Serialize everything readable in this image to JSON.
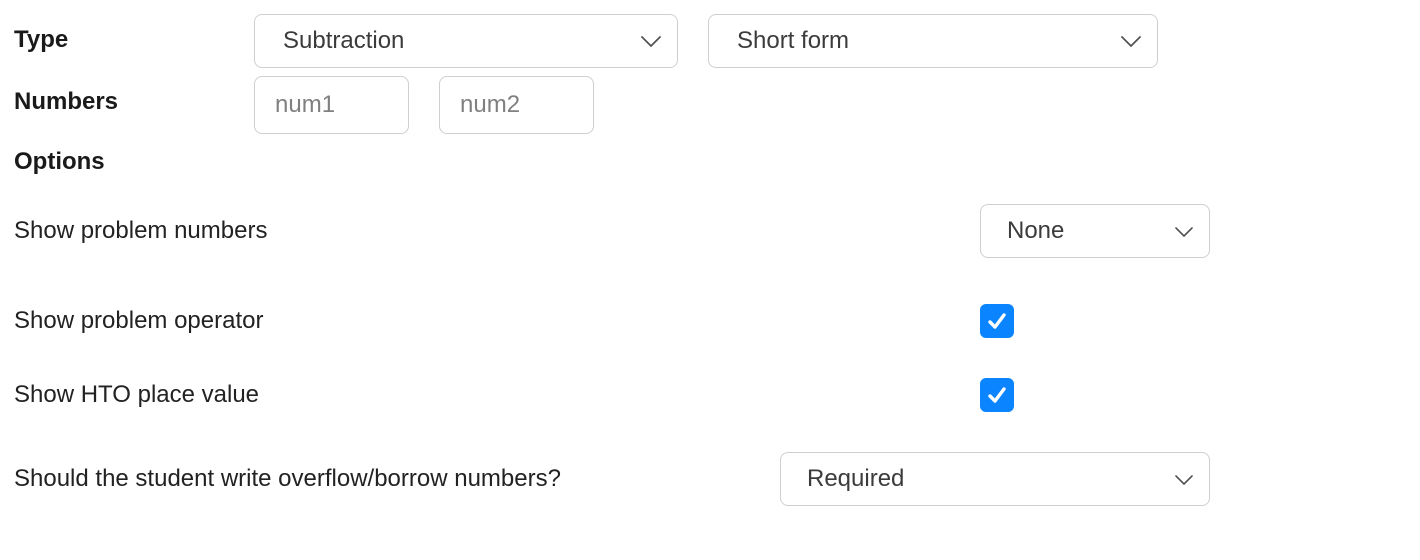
{
  "labels": {
    "type": "Type",
    "numbers": "Numbers",
    "options": "Options"
  },
  "type_select": {
    "value": "Subtraction"
  },
  "form_select": {
    "value": "Short form"
  },
  "num_inputs": {
    "num1_placeholder": "num1",
    "num2_placeholder": "num2"
  },
  "options": {
    "show_problem_numbers": {
      "label": "Show problem numbers",
      "value": "None"
    },
    "show_problem_operator": {
      "label": "Show problem operator",
      "checked": true
    },
    "show_hto": {
      "label": "Show HTO place value",
      "checked": true
    },
    "overflow_borrow": {
      "label": "Should the student write overflow/borrow numbers?",
      "value": "Required"
    }
  }
}
